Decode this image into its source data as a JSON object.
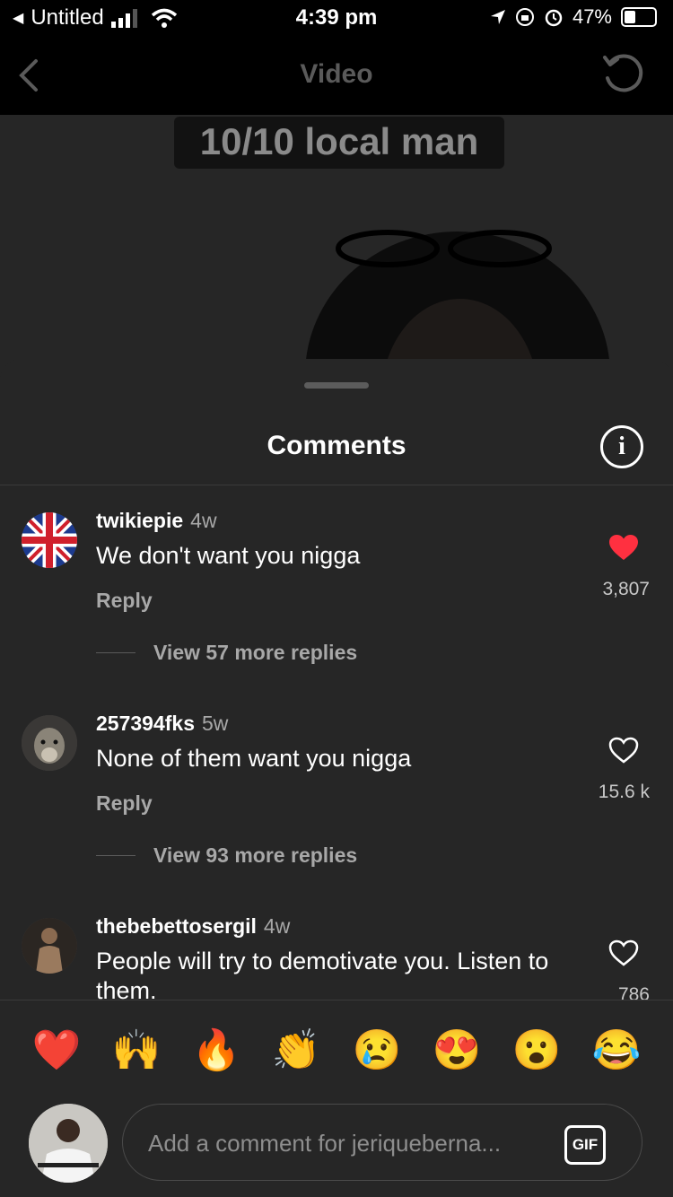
{
  "status_bar": {
    "back_app": "Untitled",
    "time": "4:39 pm",
    "battery": "47%"
  },
  "nav": {
    "title": "Video"
  },
  "video": {
    "caption": "10/10 local man"
  },
  "sheet": {
    "title": "Comments"
  },
  "comments": [
    {
      "username": "twikiepie",
      "age": "4w",
      "text": "We don't want you nigga",
      "reply_label": "Reply",
      "view_replies": "View 57 more replies",
      "likes": "3,807",
      "liked": true
    },
    {
      "username": "257394fks",
      "age": "5w",
      "text": "None of them want you nigga",
      "reply_label": "Reply",
      "view_replies": "View 93 more replies",
      "likes": "15.6 k",
      "liked": false
    },
    {
      "username": "thebebettosergil",
      "age": "4w",
      "text": "People will try to demotivate you. Listen to them.",
      "likes": "786",
      "liked": false
    }
  ],
  "reactions": [
    "❤️",
    "🙌",
    "🔥",
    "👏",
    "😢",
    "😍",
    "😮",
    "😂"
  ],
  "composer": {
    "placeholder": "Add a comment for jeriqueberna...",
    "gif_label": "GIF"
  },
  "colors": {
    "like_red": "#ff3040",
    "sheet_bg": "#262626"
  }
}
